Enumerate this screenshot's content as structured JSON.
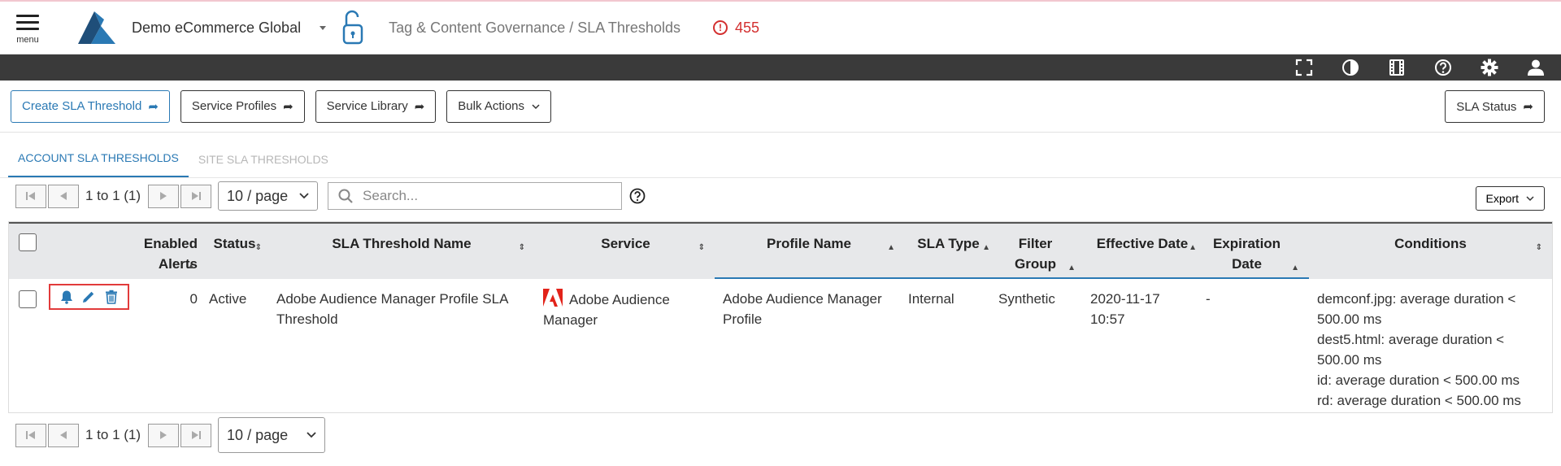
{
  "header": {
    "menu_label": "menu",
    "account_name": "Demo eCommerce Global",
    "breadcrumb": "Tag & Content Governance / SLA Thresholds",
    "alert_count": "455",
    "alert_icon_text": "!"
  },
  "toolbar_icons": [
    "fullscreen-icon",
    "contrast-icon",
    "film-icon",
    "help-icon",
    "gear-icon",
    "user-icon"
  ],
  "actions": {
    "create": "Create SLA Threshold",
    "profiles": "Service Profiles",
    "library": "Service Library",
    "bulk": "Bulk Actions",
    "sla_status": "SLA Status"
  },
  "tabs": [
    {
      "label": "ACCOUNT SLA THRESHOLDS",
      "active": true
    },
    {
      "label": "SITE SLA THRESHOLDS",
      "active": false
    }
  ],
  "pager": {
    "range": "1 to 1 (1)",
    "per_page": "10 / page",
    "search_placeholder": "Search...",
    "export": "Export"
  },
  "table": {
    "headers": {
      "enabled_alerts": "Enabled Alerts",
      "status": "Status",
      "name": "SLA Threshold Name",
      "service": "Service",
      "profile": "Profile Name",
      "type": "SLA Type",
      "filter": "Filter Group",
      "effective": "Effective Date",
      "expiration": "Expiration Date",
      "conditions": "Conditions"
    },
    "rows": [
      {
        "enabled_alerts": "0",
        "status": "Active",
        "name": "Adobe Audience Manager Profile SLA Threshold",
        "service": "Adobe Audience Manager",
        "profile": "Adobe Audience Manager Profile",
        "type": "Internal",
        "filter": "Synthetic",
        "effective_date": "2020-11-17",
        "effective_time": "10:57",
        "expiration": "-",
        "conditions": [
          "demconf.jpg: average duration < 500.00 ms",
          "dest5.html: average duration < 500.00 ms",
          "id: average duration < 500.00 ms",
          "rd: average duration < 500.00 ms"
        ]
      }
    ]
  },
  "colors": {
    "accent": "#2a79b4",
    "active_status": "#6aa63a",
    "alert": "#d32f2f",
    "dark_bar": "#3a3a3a",
    "header_row": "#e7e8ea"
  }
}
